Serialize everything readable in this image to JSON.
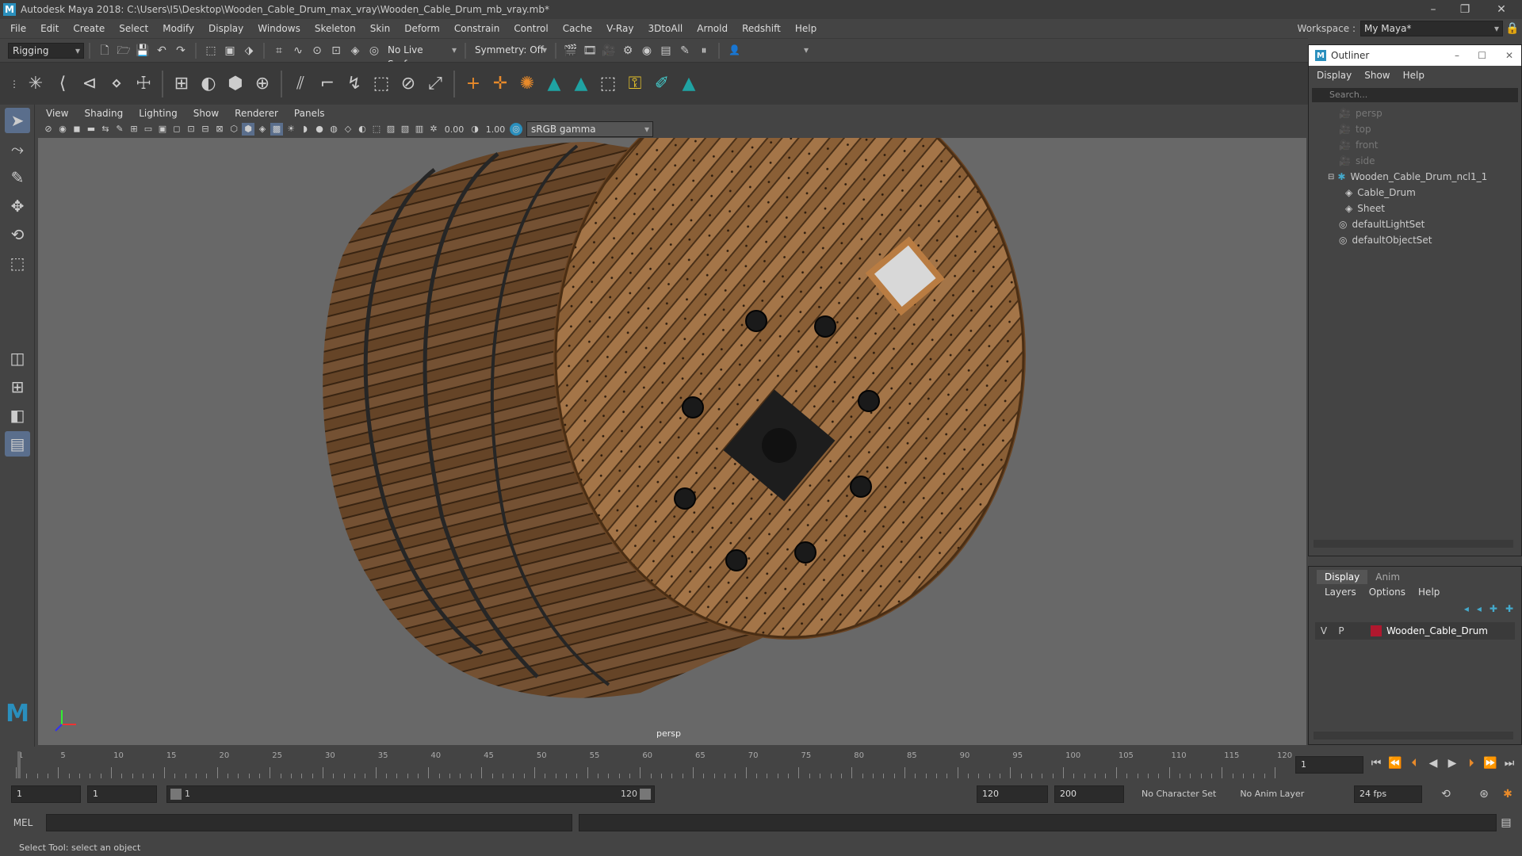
{
  "window": {
    "title": "Autodesk Maya 2018: C:\\Users\\I5\\Desktop\\Wooden_Cable_Drum_max_vray\\Wooden_Cable_Drum_mb_vray.mb*",
    "logo": "M"
  },
  "menubar": {
    "items": [
      "File",
      "Edit",
      "Create",
      "Select",
      "Modify",
      "Display",
      "Windows",
      "Skeleton",
      "Skin",
      "Deform",
      "Constrain",
      "Control",
      "Cache",
      "V-Ray",
      "3DtoAll",
      "Arnold",
      "Redshift",
      "Help"
    ]
  },
  "workspace": {
    "label": "Workspace :",
    "value": "My Maya*"
  },
  "statusline": {
    "menuset": "Rigging",
    "live_surface": "No Live Surface",
    "symmetry": "Symmetry: Off"
  },
  "panel": {
    "menus": [
      "View",
      "Shading",
      "Lighting",
      "Show",
      "Renderer",
      "Panels"
    ],
    "exposure": "0.00",
    "gamma": "1.00",
    "colorspace": "sRGB gamma",
    "camera": "persp"
  },
  "outliner": {
    "title": "Outliner",
    "menus": [
      "Display",
      "Show",
      "Help"
    ],
    "search_placeholder": "Search...",
    "items": [
      {
        "label": "persp",
        "dim": true
      },
      {
        "label": "top",
        "dim": true
      },
      {
        "label": "front",
        "dim": true
      },
      {
        "label": "side",
        "dim": true
      },
      {
        "label": "Wooden_Cable_Drum_ncl1_1",
        "dim": false
      },
      {
        "label": "Cable_Drum",
        "dim": false
      },
      {
        "label": "Sheet",
        "dim": false
      },
      {
        "label": "defaultLightSet",
        "dim": false
      },
      {
        "label": "defaultObjectSet",
        "dim": false
      }
    ]
  },
  "layers": {
    "tabs": [
      "Display",
      "Anim"
    ],
    "menus": [
      "Layers",
      "Options",
      "Help"
    ],
    "row": {
      "v": "V",
      "p": "P",
      "name": "Wooden_Cable_Drum",
      "color": "#b0182e"
    }
  },
  "timeline": {
    "ticks": [
      "1",
      "5",
      "10",
      "15",
      "20",
      "25",
      "30",
      "35",
      "40",
      "45",
      "50",
      "55",
      "60",
      "65",
      "70",
      "75",
      "80",
      "85",
      "90",
      "95",
      "100",
      "105",
      "110",
      "115",
      "120"
    ],
    "current_frame": "1"
  },
  "range": {
    "start": "1",
    "playback_start": "1",
    "slider_start": "1",
    "slider_end": "120",
    "playback_end": "120",
    "end": "200",
    "character_set": "No Character Set",
    "anim_layer": "No Anim Layer",
    "fps": "24 fps"
  },
  "cmdline": {
    "label": "MEL"
  },
  "helpline": {
    "text": "Select Tool: select an object"
  }
}
